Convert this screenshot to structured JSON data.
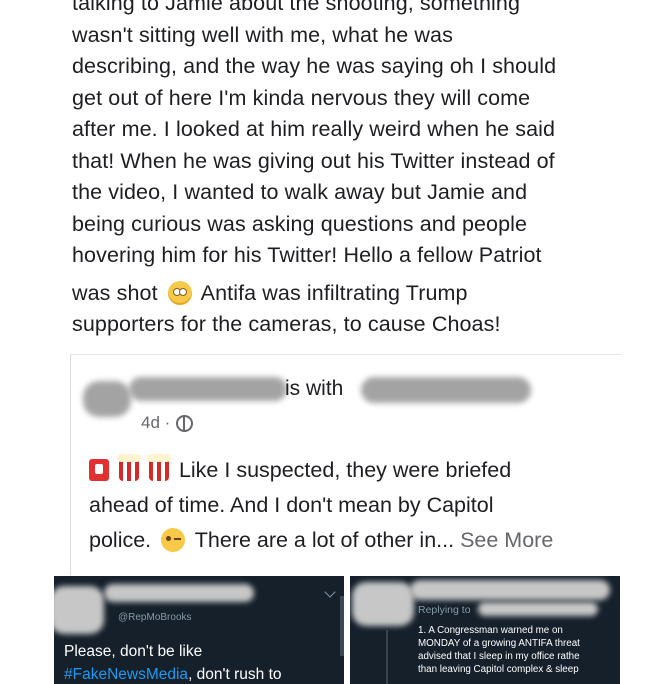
{
  "post": {
    "lines": [
      "talking to Jamie about the shooting, something",
      "wasn't sitting well with me, what he was",
      "describing, and the way he was saying oh I should",
      "get out of here I'm kinda nervous they will come",
      "after me. I looked at him really weird when he said",
      "that! When he was giving out his Twitter instead of",
      "the video, I wanted to walk away but Jamie and",
      "being curious was asking questions and people",
      "hovering him for his Twitter! Hello a fellow Patriot"
    ],
    "line_emoji_before": "was shot",
    "line_emoji_after": "Antifa was infiltrating Trump",
    "last_line": "supporters for the cameras, to cause Choas!"
  },
  "shared": {
    "is_with": "is with",
    "time": "4d ·",
    "line1": "Like I suspected, they were briefed",
    "line2": "ahead of time. And I don't mean by Capitol",
    "line3_before": "police.",
    "line3_after": "There are a lot of other in...",
    "see_more": "See More"
  },
  "tweet_left": {
    "handle": "@RepMoBrooks",
    "body_line1": "Please, don't be like",
    "hashtag": "#FakeNewsMedia",
    "body_line2_rest": ", don't rush to"
  },
  "tweet_right": {
    "replying": "Replying to",
    "lines": [
      "1. A Congressman warned me on",
      "MONDAY of a growing ANTIFA threat",
      "advised that I sleep in my office rathe",
      "than leaving Capitol complex & sleep"
    ]
  },
  "icons": {
    "globe": "globe-icon",
    "astonished_face": "flushed-face-icon",
    "wink_face": "winking-face-icon",
    "red_box": "red-box-icon",
    "popcorn": "popcorn-icon"
  }
}
